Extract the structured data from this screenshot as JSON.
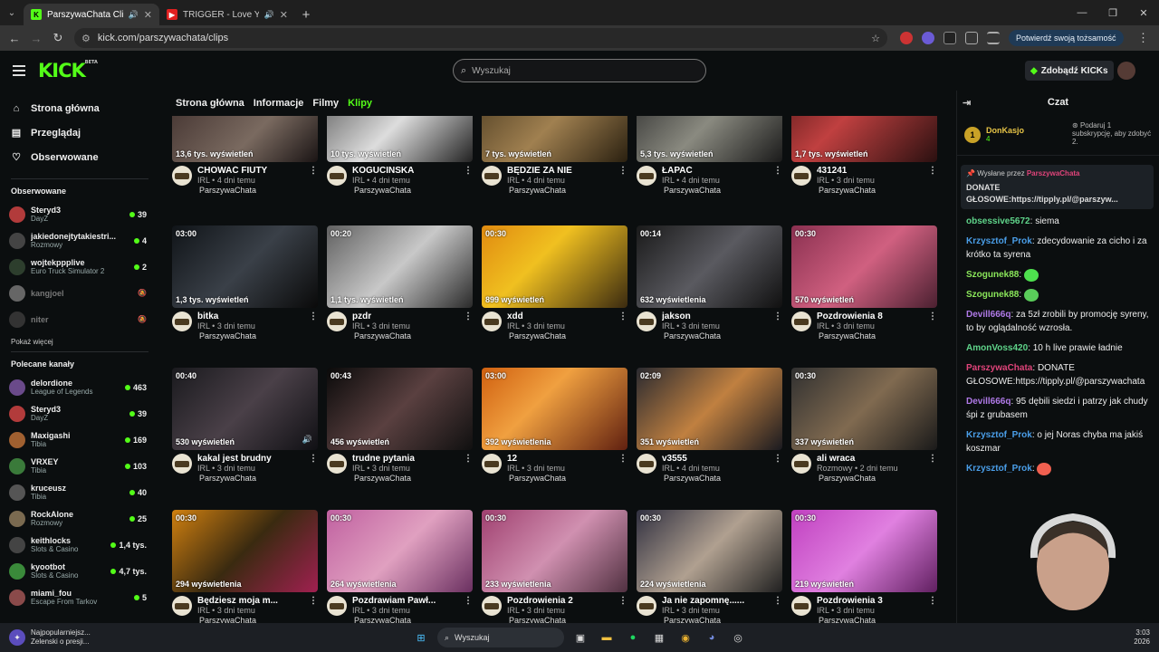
{
  "browser": {
    "tabs": [
      {
        "title": "ParszywaChata Clips - Watch",
        "active": true
      },
      {
        "title": "TRIGGER - Love You Again |",
        "active": false
      }
    ],
    "url": "kick.com/parszywachata/clips",
    "verify_label": "Potwierdź swoją tożsamość"
  },
  "header": {
    "logo": "KICK",
    "logo_tag": "BETA",
    "search_placeholder": "Wyszukaj",
    "get_kicks": "Zdobądź KICKs"
  },
  "sidebar": {
    "nav": [
      {
        "label": "Strona główna",
        "icon": "home-icon"
      },
      {
        "label": "Przeglądaj",
        "icon": "browse-icon"
      },
      {
        "label": "Obserwowane",
        "icon": "heart-icon"
      }
    ],
    "followed_title": "Obserwowane",
    "followed": [
      {
        "name": "Steryd3",
        "category": "DayZ",
        "viewers": "39",
        "online": true,
        "color": "#b23b3b"
      },
      {
        "name": "jakiedonejtytakiestri...",
        "category": "Rozmowy",
        "viewers": "4",
        "online": true,
        "color": "#444"
      },
      {
        "name": "wojtekppplive",
        "category": "Euro Truck Simulator 2",
        "viewers": "2",
        "online": true,
        "color": "#2d3e2d"
      },
      {
        "name": "kangjoel",
        "category": "",
        "viewers": "",
        "online": false,
        "color": "#666"
      },
      {
        "name": "niter",
        "category": "",
        "viewers": "",
        "online": false,
        "color": "#333"
      }
    ],
    "show_more": "Pokaż więcej",
    "recommended_title": "Polecane kanały",
    "recommended": [
      {
        "name": "delordione",
        "category": "League of Legends",
        "viewers": "463",
        "color": "#6a4a8a"
      },
      {
        "name": "Steryd3",
        "category": "DayZ",
        "viewers": "39",
        "color": "#b23b3b"
      },
      {
        "name": "Maxigashi",
        "category": "Tibia",
        "viewers": "169",
        "color": "#a06030"
      },
      {
        "name": "VRXEY",
        "category": "Tibia",
        "viewers": "103",
        "color": "#3a7a3a"
      },
      {
        "name": "kruceusz",
        "category": "Tibia",
        "viewers": "40",
        "color": "#555"
      },
      {
        "name": "RockAlone",
        "category": "Rozmowy",
        "viewers": "25",
        "color": "#7a6a50"
      },
      {
        "name": "keithlocks",
        "category": "Slots & Casino",
        "viewers": "1,4 tys.",
        "color": "#444"
      },
      {
        "name": "kyootbot",
        "category": "Slots & Casino",
        "viewers": "4,7 tys.",
        "color": "#3a8a3a"
      },
      {
        "name": "miami_fou",
        "category": "Escape From Tarkov",
        "viewers": "5",
        "color": "#8a4a4a"
      }
    ]
  },
  "subnav": [
    {
      "label": "Strona główna",
      "active": false
    },
    {
      "label": "Informacje",
      "active": false
    },
    {
      "label": "Filmy",
      "active": false
    },
    {
      "label": "Klipy",
      "active": true
    }
  ],
  "clips": [
    {
      "duration": "",
      "views": "13,6 tys. wyświetleń",
      "title": "CHOWAĆ FIUTY",
      "meta": "IRL • 4 dni temu",
      "author": "ParszywaChata",
      "bg": "linear-gradient(135deg,#3a2a28,#7a6a60 60%,#1a1414)"
    },
    {
      "duration": "",
      "views": "10 tys. wyświetleń",
      "title": "KOGUCINSKA",
      "meta": "IRL • 4 dni temu",
      "author": "ParszywaChata",
      "bg": "linear-gradient(135deg,#555,#ddd 50%,#222)"
    },
    {
      "duration": "",
      "views": "7 tys. wyświetleń",
      "title": "BĘDZIE ZA NIE",
      "meta": "IRL • 4 dni temu",
      "author": "ParszywaChata",
      "bg": "linear-gradient(135deg,#4a3a20,#a08050 50%,#2a2010)"
    },
    {
      "duration": "",
      "views": "5,3 tys. wyświetleń",
      "title": "ŁAPAĆ",
      "meta": "IRL • 4 dni temu",
      "author": "ParszywaChata",
      "bg": "linear-gradient(135deg,#2a2a2a,#8a8a80 50%,#1a1a1a)"
    },
    {
      "duration": "",
      "views": "1,7 tys. wyświetleń",
      "title": "431241",
      "meta": "IRL • 3 dni temu",
      "author": "ParszywaChata",
      "bg": "linear-gradient(135deg,#5a1a1a,#c04040 40%,#2a1010)"
    },
    {
      "duration": "03:00",
      "views": "1,3 tys. wyświetleń",
      "title": "bitka",
      "meta": "IRL • 3 dni temu",
      "author": "ParszywaChata",
      "bg": "linear-gradient(135deg,#101418,#3a4048 50%,#0a0a0a)"
    },
    {
      "duration": "00:20",
      "views": "1,1 tys. wyświetleń",
      "title": "pzdr",
      "meta": "IRL • 3 dni temu",
      "author": "ParszywaChata",
      "bg": "linear-gradient(135deg,#606060,#c8c8c8 50%,#2a2a2a)"
    },
    {
      "duration": "00:30",
      "views": "899 wyświetleń",
      "title": "xdd",
      "meta": "IRL • 3 dni temu",
      "author": "ParszywaChata",
      "bg": "linear-gradient(135deg,#e08a10,#f0c020 40%,#3a2a10)"
    },
    {
      "duration": "00:14",
      "views": "632 wyświetlenia",
      "title": "jakson",
      "meta": "IRL • 3 dni temu",
      "author": "ParszywaChata",
      "bg": "linear-gradient(135deg,#1a1a1a,#5a5a60 50%,#101010)"
    },
    {
      "duration": "00:30",
      "views": "570 wyświetleń",
      "title": "Pozdrowienia 8",
      "meta": "IRL • 3 dni temu",
      "author": "ParszywaChata",
      "bg": "linear-gradient(135deg,#8a3050,#d06080 50%,#4a2030)"
    },
    {
      "duration": "00:40",
      "views": "530 wyświetleń",
      "title": "kakal jest brudny",
      "meta": "IRL • 3 dni temu",
      "author": "ParszywaChata",
      "bg": "linear-gradient(135deg,#1a1a1e,#4a4048 50%,#101014)"
    },
    {
      "duration": "00:43",
      "views": "456 wyświetleń",
      "title": "trudne pytania",
      "meta": "IRL • 3 dni temu",
      "author": "ParszywaChata",
      "bg": "linear-gradient(135deg,#0a0a0a,#5a4040 50%,#101010)"
    },
    {
      "duration": "03:00",
      "views": "392 wyświetlenia",
      "title": "12",
      "meta": "IRL • 3 dni temu",
      "author": "ParszywaChata",
      "bg": "linear-gradient(135deg,#d06010,#f0a040 40%,#602010)"
    },
    {
      "duration": "02:09",
      "views": "351 wyświetleń",
      "title": "v3555",
      "meta": "IRL • 4 dni temu",
      "author": "ParszywaChata",
      "bg": "linear-gradient(135deg,#2a2a30,#c08040 50%,#1a1a20)"
    },
    {
      "duration": "00:30",
      "views": "337 wyświetleń",
      "title": "ali wraca",
      "meta": "Rozmowy • 2 dni temu",
      "author": "ParszywaChata",
      "bg": "linear-gradient(135deg,#303030,#806a50 50%,#1a1a1a)"
    },
    {
      "duration": "00:30",
      "views": "294 wyświetlenia",
      "title": "Będziesz moja m...",
      "meta": "IRL • 3 dni temu",
      "author": "ParszywaChata",
      "bg": "linear-gradient(135deg,#d08010,#3a2a10 50%,#a02050)"
    },
    {
      "duration": "00:30",
      "views": "264 wyświetlenia",
      "title": "Pozdrawiam Pawł...",
      "meta": "IRL • 3 dni temu",
      "author": "ParszywaChata",
      "bg": "linear-gradient(135deg,#c060a0,#e0a0c0 50%,#6a3060)"
    },
    {
      "duration": "00:30",
      "views": "233 wyświetlenia",
      "title": "Pozdrowienia 2",
      "meta": "IRL • 3 dni temu",
      "author": "ParszywaChata",
      "bg": "linear-gradient(135deg,#a04070,#d090b0 50%,#503040)"
    },
    {
      "duration": "00:30",
      "views": "224 wyświetlenia",
      "title": "Ja nie zapomnę......",
      "meta": "IRL • 3 dni temu",
      "author": "ParszywaChata",
      "bg": "linear-gradient(135deg,#303040,#b0a090 50%,#202020)"
    },
    {
      "duration": "00:30",
      "views": "219 wyświetleń",
      "title": "Pozdrowienia 3",
      "meta": "IRL • 3 dni temu",
      "author": "ParszywaChata",
      "bg": "linear-gradient(135deg,#c040c0,#e080e0 50%,#602060)"
    }
  ],
  "chat": {
    "title": "Czat",
    "top_gifter": {
      "rank": "1",
      "name": "DonKasjo",
      "count": "4",
      "hint": "Podaruj 1 subskrypcję, aby zdobyć 2."
    },
    "pinned": {
      "by_label": "Wysłane przez",
      "by_user": "ParszywaChata",
      "text": "DONATE GŁOSOWE:https://tipply.pl/@parszyw..."
    },
    "messages": [
      {
        "user": "obsessive5672",
        "color": "#5fd48a",
        "text": "siema"
      },
      {
        "user": "Krzysztof_Prok",
        "color": "#4a9ee8",
        "text": "zdecydowanie za cicho i za krótko ta syrena"
      },
      {
        "user": "Szogunek88",
        "color": "#8ae65a",
        "text": ""
      },
      {
        "user": "Szogunek88",
        "color": "#8ae65a",
        "text": ""
      },
      {
        "user": "Devill666q",
        "color": "#b07ae8",
        "text": "za 5zł zrobili by promocję syreny, to by oglądalność wzrosła."
      },
      {
        "user": "AmonVoss420",
        "color": "#5fd48a",
        "text": "10 h live prawie ładnie"
      },
      {
        "user": "ParszywaChata",
        "color": "#e0447a",
        "text": "DONATE GŁOSOWE:https://tipply.pl/@parszywachata"
      },
      {
        "user": "Devill666q",
        "color": "#b07ae8",
        "text": "95 dębili siedzi i patrzy jak chudy śpi z grubasem"
      },
      {
        "user": "Krzysztof_Prok",
        "color": "#4a9ee8",
        "text": "o jej Noras chyba ma jakiś koszmar"
      },
      {
        "user": "Krzysztof_Prok",
        "color": "#4a9ee8",
        "text": ""
      }
    ]
  },
  "taskbar": {
    "news_title": "Najpopularniejsz...",
    "news_sub": "Zelenski o presji...",
    "search": "Wyszukaj",
    "time": "3:03",
    "date": "2026"
  },
  "colors": {
    "brand": "#53fc18",
    "bg": "#0b0e0f",
    "live": "#53fc18"
  }
}
